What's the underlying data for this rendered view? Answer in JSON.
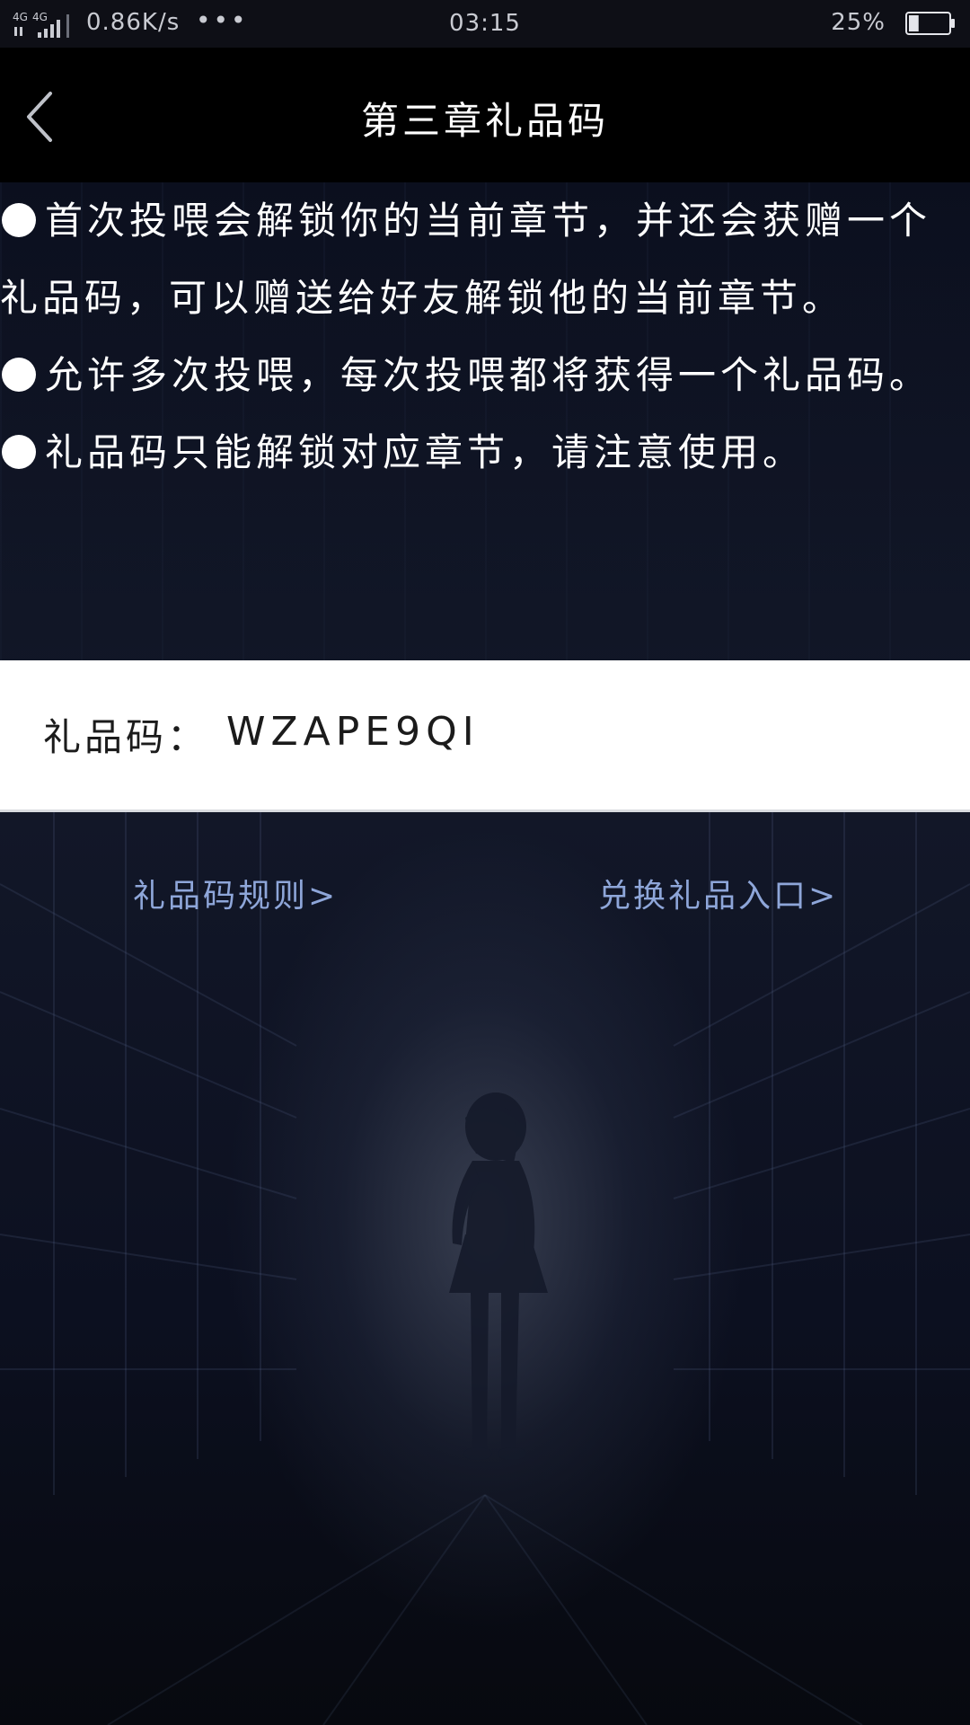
{
  "status_bar": {
    "network": "4G 4G",
    "net_speed": "0.86K/s",
    "more": "•••",
    "time": "03:15",
    "battery_percent": "25%",
    "battery_level": 0.25
  },
  "header": {
    "title": "第三章礼品码",
    "back_icon": "chevron-left-icon"
  },
  "description": {
    "items": [
      "首次投喂会解锁你的当前章节，并还会获赠一个礼品码，可以赠送给好友解锁他的当前章节。",
      "允许多次投喂，每次投喂都将获得一个礼品码。",
      "礼品码只能解锁对应章节，请注意使用。"
    ]
  },
  "code_card": {
    "label": "礼品码：",
    "value": "WZAPE9QI"
  },
  "links": {
    "rules": "礼品码规则>",
    "redeem": "兑换礼品入口>"
  },
  "colors": {
    "link": "#8ea6d9",
    "header_bg": "#000000",
    "card_bg": "#ffffff"
  }
}
